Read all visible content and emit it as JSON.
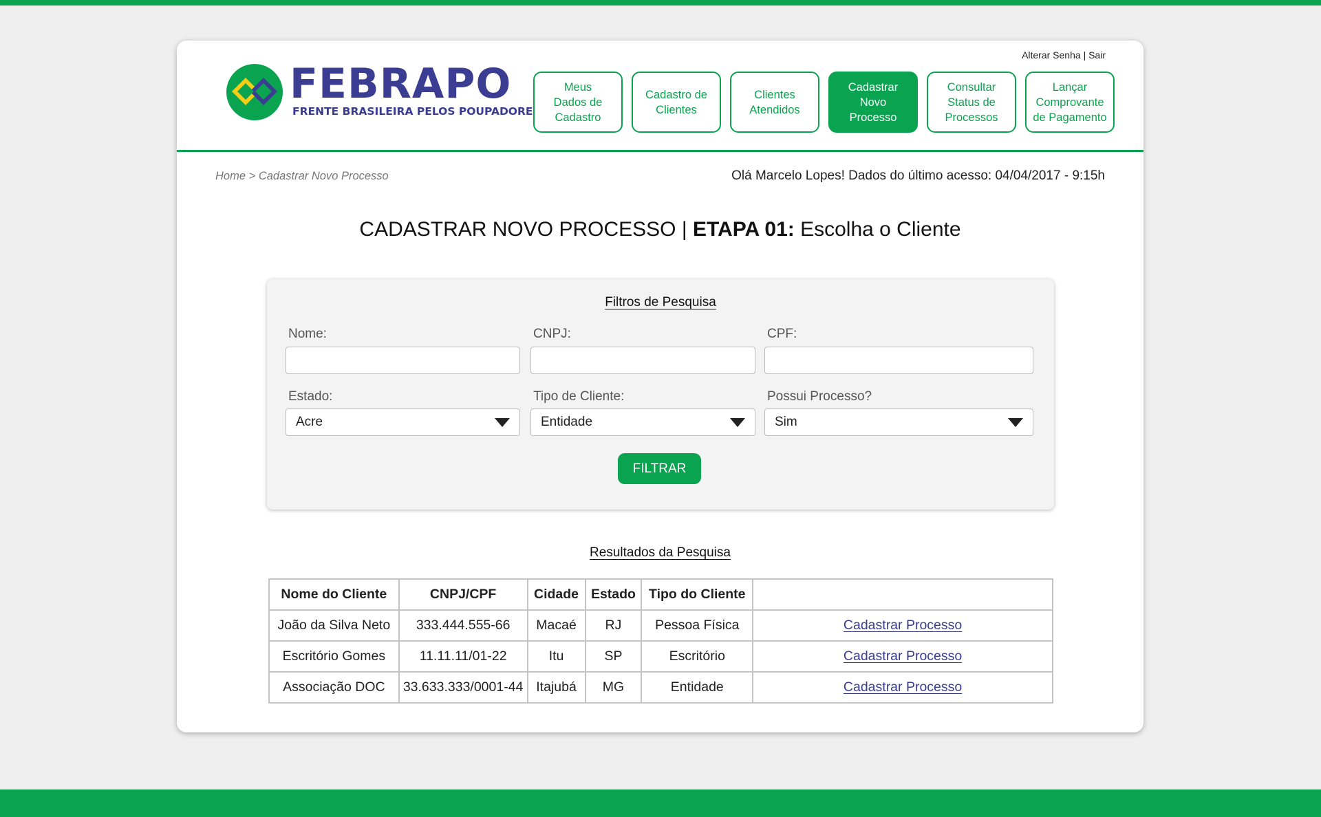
{
  "brand": {
    "name": "FEBRAPO",
    "tagline": "FRENTE BRASILEIRA PELOS POUPADORES",
    "colors": {
      "primary": "#0aa34f",
      "brand_blue": "#3a3d92",
      "brand_yellow": "#f3cd16"
    }
  },
  "top_links": {
    "change_password": "Alterar Senha",
    "separator": "|",
    "logout": "Sair"
  },
  "nav": [
    {
      "label": "Meus\nDados de\nCadastro",
      "active": false
    },
    {
      "label": "Cadastro de\nClientes",
      "active": false
    },
    {
      "label": "Clientes\nAtendidos",
      "active": false
    },
    {
      "label": "Cadastrar\nNovo\nProcesso",
      "active": true
    },
    {
      "label": "Consultar\nStatus de\nProcessos",
      "active": false
    },
    {
      "label": "Lançar\nComprovante\nde Pagamento",
      "active": false
    }
  ],
  "breadcrumb": "Home > Cadastrar Novo Processo",
  "welcome": "Olá Marcelo Lopes! Dados do último acesso: 04/04/2017 - 9:15h",
  "page_title": {
    "prefix": "CADASTRAR NOVO PROCESSO | ",
    "step": "ETAPA 01:",
    "suffix": " Escolha o Cliente"
  },
  "filters": {
    "title": "Filtros de Pesquisa",
    "name_label": "Nome:",
    "name_value": "",
    "cnpj_label": "CNPJ:",
    "cnpj_value": "",
    "cpf_label": "CPF:",
    "cpf_value": "",
    "state_label": "Estado:",
    "state_value": "Acre",
    "client_type_label": "Tipo de Cliente:",
    "client_type_value": "Entidade",
    "has_process_label": "Possui Processo?",
    "has_process_value": "Sim",
    "filter_button": "FILTRAR"
  },
  "results": {
    "title": "Resultados da Pesquisa",
    "columns": [
      "Nome do Cliente",
      "CNPJ/CPF",
      "Cidade",
      "Estado",
      "Tipo do Cliente",
      ""
    ],
    "rows": [
      {
        "name": "João da Silva Neto",
        "doc": "333.444.555-66",
        "city": "Macaé",
        "state": "RJ",
        "type": "Pessoa Física",
        "action": "Cadastrar Processo"
      },
      {
        "name": "Escritório Gomes",
        "doc": "11.11.11/01-22",
        "city": "Itu",
        "state": "SP",
        "type": "Escritório",
        "action": "Cadastrar Processo"
      },
      {
        "name": "Associação DOC",
        "doc": "33.633.333/0001-44",
        "city": "Itajubá",
        "state": "MG",
        "type": "Entidade",
        "action": "Cadastrar Processo"
      }
    ]
  }
}
